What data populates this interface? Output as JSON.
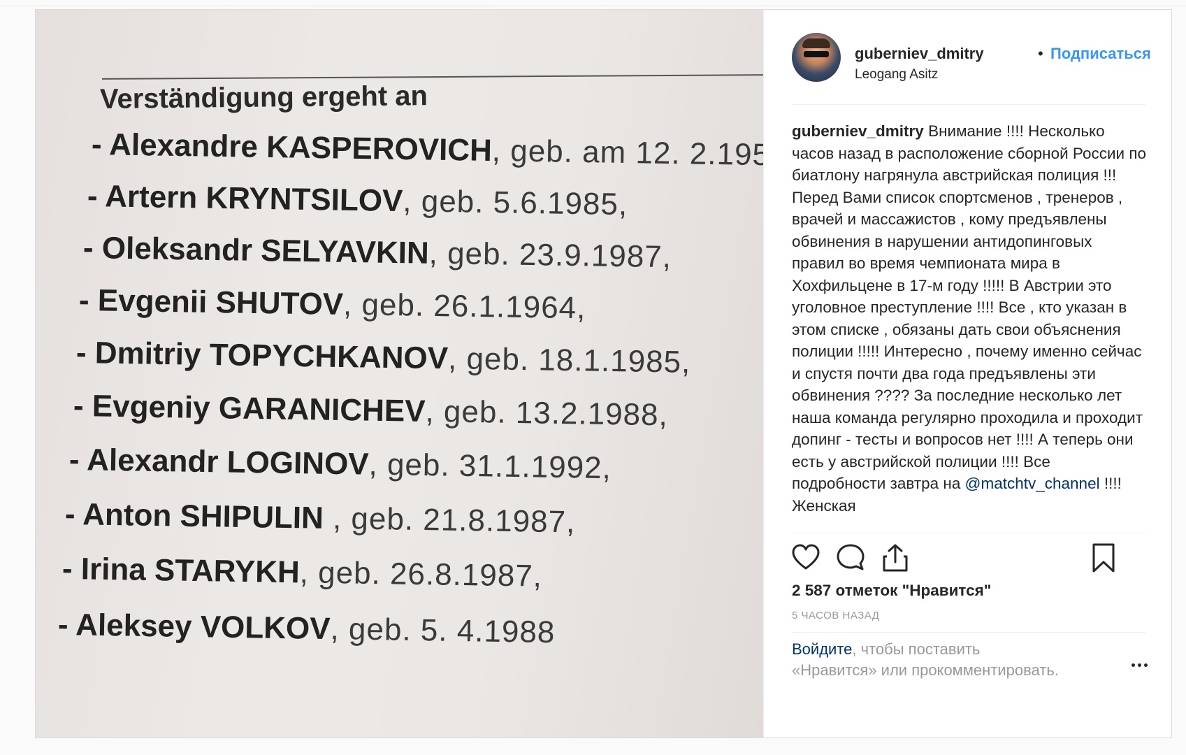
{
  "photo": {
    "heading": "Verständigung ergeht an",
    "entries": [
      {
        "name": "- Alexandre KASPEROVICH",
        "birth": ", geb. am 12. 2.195"
      },
      {
        "name": "- Artern KRYNTSILOV",
        "birth": ", geb. 5.6.1985,"
      },
      {
        "name": "- Oleksandr SELYAVKIN",
        "birth": ", geb. 23.9.1987,"
      },
      {
        "name": "- Evgenii SHUTOV",
        "birth": ", geb. 26.1.1964,"
      },
      {
        "name": "- Dmitriy TOPYCHKANOV",
        "birth": ", geb. 18.1.1985,"
      },
      {
        "name": "- Evgeniy GARANICHEV",
        "birth": ", geb. 13.2.1988,"
      },
      {
        "name": "- Alexandr LOGINOV",
        "birth": ", geb. 31.1.1992,"
      },
      {
        "name": "- Anton SHIPULIN",
        "birth": " , geb. 21.8.1987,"
      },
      {
        "name": "- Irina STARYKH",
        "birth": ", geb. 26.8.1987,"
      },
      {
        "name": "- Aleksey VOLKOV",
        "birth": ", geb. 5. 4.1988"
      }
    ]
  },
  "header": {
    "username": "guberniev_dmitry",
    "separator": "•",
    "follow_label": "Подписаться",
    "location": "Leogang Asitz"
  },
  "caption": {
    "username": "guberniev_dmitry",
    "text_before_mention": "Внимание !!!! Несколько часов назад в расположение сборной России по биатлону нагрянула австрийская полиция !!! Перед Вами список спортсменов , тренеров , врачей и массажистов , кому предъявлены обвинения в нарушении антидопинговых правил во время чемпионата мира в Хохфильцене в 17-м году !!!!! В Австрии это уголовное преступление !!!! Все , кто указан в этом списке , обязаны дать свои объяснения полиции !!!!! Интересно , почему именно сейчас и спустя почти два года предъявлены эти обвинения ???? За последние несколько лет наша команда регулярно проходила и проходит допинг - тесты и вопросов нет !!!! А теперь они есть у австрийской полиции !!!! Все подробности завтра на",
    "mention": "@matchtv_channel",
    "text_after_mention": "!!!! Женская"
  },
  "actions": {
    "like_icon": "heart-icon",
    "comment_icon": "speech-bubble-icon",
    "share_icon": "share-icon",
    "save_icon": "bookmark-icon"
  },
  "likes_text": "2 587 отметок \"Нравится\"",
  "time_text": "5 ЧАСОВ НАЗАД",
  "login": {
    "link": "Войдите",
    "rest_line1": ", чтобы поставить",
    "line2": "«Нравится» или прокомментировать."
  },
  "colors": {
    "link_blue": "#3897f0",
    "mention_blue": "#003569",
    "text": "#262626",
    "muted": "#999999"
  }
}
